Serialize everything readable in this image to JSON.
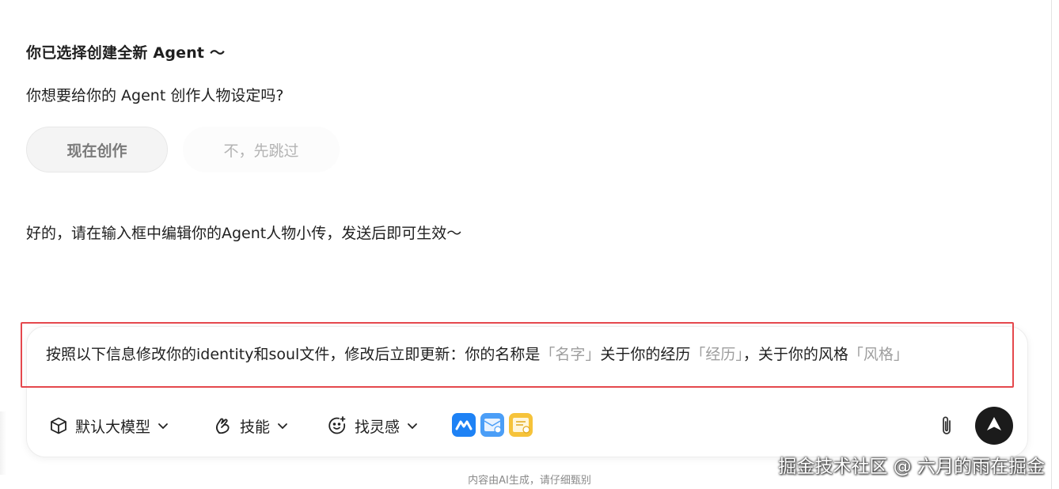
{
  "chat": {
    "title": "你已选择创建全新 Agent 〜",
    "question": "你想要给你的 Agent 创作人物设定吗?",
    "choice_create": "现在创作",
    "choice_skip": "不，先跳过",
    "answer": "好的，请在输入框中编辑你的Agent人物小传，发送后即可生效〜"
  },
  "composer": {
    "text_prefix": "按照以下信息修改你的identity和soul文件，修改后立即更新：你的名称是",
    "placeholder_name": "「名字」",
    "text_mid1": "关于你的经历",
    "placeholder_experience": "「经历」",
    "text_mid2": "，关于你的风格",
    "placeholder_style": "「风格」"
  },
  "toolbar": {
    "model_label": "默认大模型",
    "skill_label": "技能",
    "inspiration_label": "找灵感",
    "icons": [
      "cube-icon",
      "skill-hand-icon",
      "smile-icon",
      "app-icon-blue",
      "app-icon-mail",
      "app-icon-note",
      "paperclip-icon",
      "send-arrow-icon"
    ]
  },
  "footer": {
    "disclaimer": "内容由AI生成，请仔细甄别"
  },
  "watermark": "掘金技术社区 @ 六月的雨在掘金",
  "colors": {
    "highlight": "#e5484d",
    "send_button": "#1b1b1b",
    "placeholder": "#9e9e9e"
  }
}
